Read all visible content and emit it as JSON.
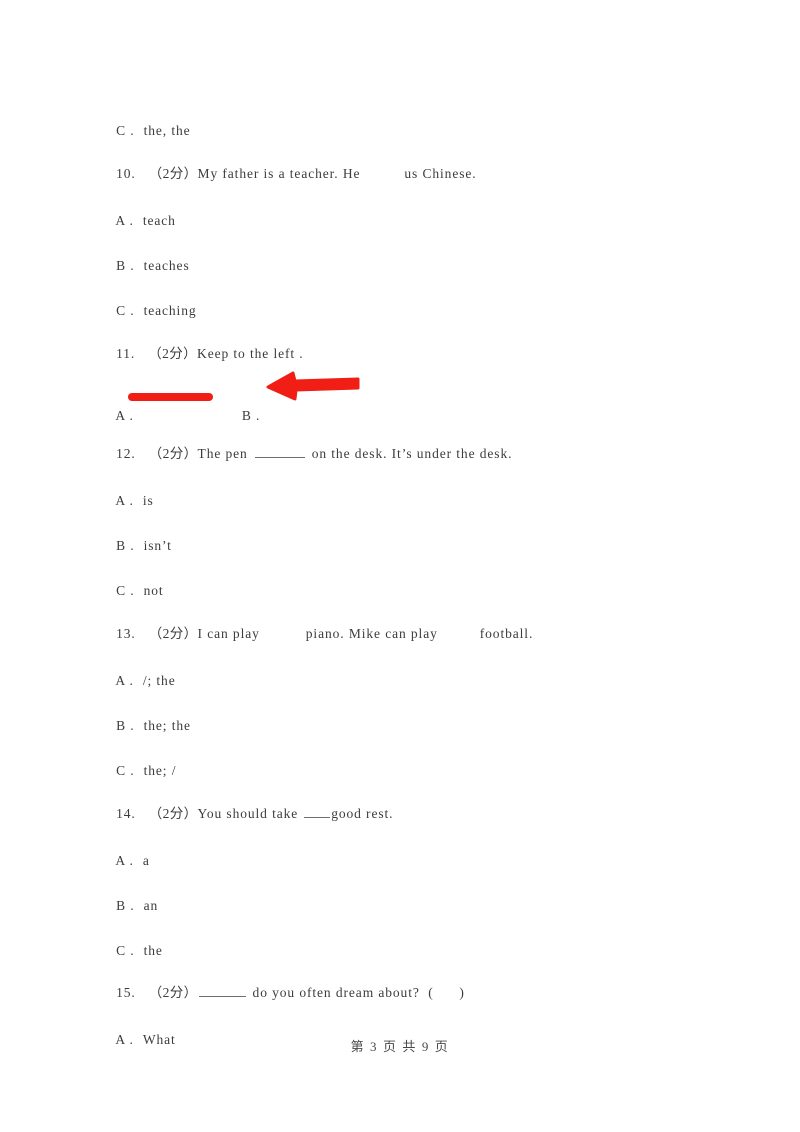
{
  "document": {
    "type": "exam-worksheet",
    "language": "zh-CN + en",
    "points_marker": "（2分）"
  },
  "colors": {
    "text": "#3c3c3c",
    "blank_rule": "#6e6e6e",
    "annotation_red": "#f01e14",
    "page_background": "#ffffff"
  },
  "carryover_option": {
    "label": "C .",
    "text": "the, the"
  },
  "questions": [
    {
      "number": "10.",
      "points": "（2分）",
      "stem_before": "My father is a teacher. He",
      "stem_after": "us Chinese.",
      "blank_style": "gap",
      "options": [
        {
          "label": "A .",
          "text": "teach"
        },
        {
          "label": "B .",
          "text": "teaches"
        },
        {
          "label": "C .",
          "text": "teaching"
        }
      ]
    },
    {
      "number": "11.",
      "points": "（2分）",
      "stem_before": "Keep to the left .",
      "stem_after": "",
      "blank_style": "none",
      "options": [
        {
          "label": "A .",
          "text": "",
          "graphic": "red-horizontal-bar"
        },
        {
          "label": "B .",
          "text": "",
          "graphic": "red-left-arrow"
        }
      ]
    },
    {
      "number": "12.",
      "points": "（2分）",
      "stem_before": "The pen",
      "stem_after": "on the desk. It’s under the desk.",
      "blank_style": "underline-long",
      "options": [
        {
          "label": "A .",
          "text": "is"
        },
        {
          "label": "B .",
          "text": "isn’t"
        },
        {
          "label": "C .",
          "text": "not"
        }
      ]
    },
    {
      "number": "13.",
      "points": "（2分）",
      "stem_before": "I can play",
      "stem_middle": "piano. Mike can play",
      "stem_after": "football.",
      "blank_style": "gap",
      "options": [
        {
          "label": "A .",
          "text": "/; the"
        },
        {
          "label": "B .",
          "text": "the; the"
        },
        {
          "label": "C .",
          "text": "the; /"
        }
      ]
    },
    {
      "number": "14.",
      "points": "（2分）",
      "stem_before": "You should take",
      "stem_after": "good rest.",
      "blank_style": "underline-mid",
      "options": [
        {
          "label": "A .",
          "text": "a"
        },
        {
          "label": "B .",
          "text": "an"
        },
        {
          "label": "C .",
          "text": "the"
        }
      ]
    },
    {
      "number": "15.",
      "points": "（2分）",
      "stem_before": "",
      "stem_after": "do you often dream about?  (      )",
      "blank_style": "underline-q15",
      "options": [
        {
          "label": "A .",
          "text": "What"
        }
      ]
    }
  ],
  "footer": {
    "text": "第 3 页 共 9 页",
    "page_number": "3",
    "total_pages": "9"
  }
}
